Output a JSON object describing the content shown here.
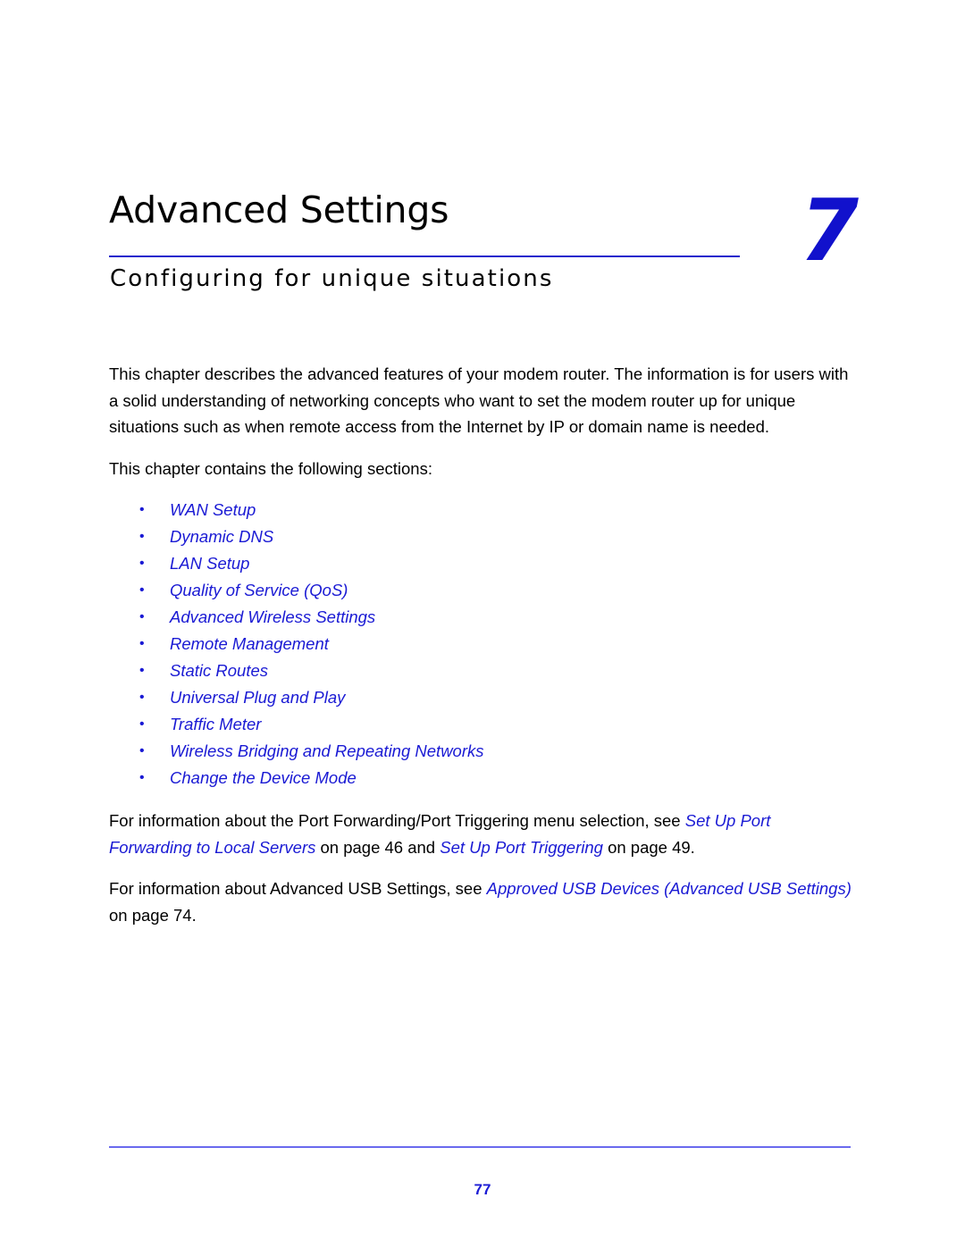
{
  "document": {
    "chapter": {
      "title": "Advanced Settings",
      "subtitle": "Configuring for unique situations",
      "number": "7"
    },
    "intro_paragraph": "This chapter describes the advanced features of your modem router. The information is for users with a solid understanding of networking concepts who want to set the modem router up for unique situations such as when remote access from the Internet by IP or domain name is needed.",
    "contains_line": "This chapter contains the following sections:",
    "bullet_glyph": "•",
    "sections": [
      {
        "label": "WAN Setup"
      },
      {
        "label": "Dynamic DNS"
      },
      {
        "label": "LAN Setup"
      },
      {
        "label": "Quality of Service (QoS)"
      },
      {
        "label": "Advanced Wireless Settings"
      },
      {
        "label": "Remote Management"
      },
      {
        "label": "Static Routes"
      },
      {
        "label": "Universal Plug and Play"
      },
      {
        "label": "Traffic Meter"
      },
      {
        "label": "Wireless Bridging and Repeating Networks"
      },
      {
        "label": "Change the Device Mode"
      }
    ],
    "cross_ref_paragraph_1": {
      "text_1": "For information about the Port Forwarding/Port Triggering menu selection, see ",
      "link_1": "Set Up Port Forwarding to Local Servers",
      "text_2": " on page 46 and ",
      "link_2": "Set Up Port Triggering",
      "text_3": " on page 49."
    },
    "cross_ref_paragraph_2": {
      "text_1": "For information about Advanced USB Settings, see ",
      "link_1": "Approved USB Devices (Advanced USB Settings)",
      "text_2": " on page 74."
    },
    "footer": {
      "page_number": "77"
    },
    "colors": {
      "link_blue": "#1a1ad4",
      "rule_blue": "#2222cc",
      "footer_rule_blue": "#6a6aee",
      "chapter_number_blue": "#1111cc",
      "text_black": "#000000"
    }
  }
}
